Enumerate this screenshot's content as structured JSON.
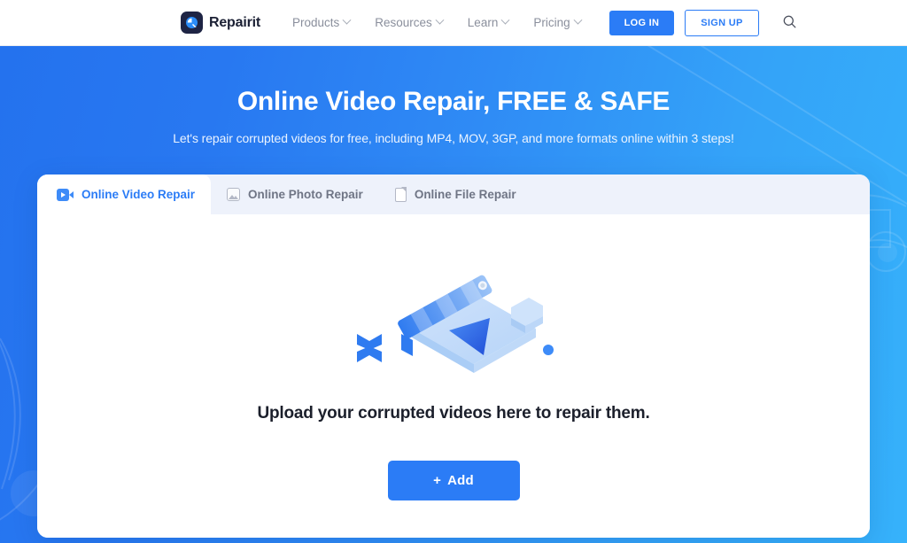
{
  "header": {
    "brand": {
      "name": "Repairit",
      "logo_icon": "repairit-logo-icon"
    },
    "nav": [
      {
        "label": "Products",
        "icon": "chevron-down-icon"
      },
      {
        "label": "Resources",
        "icon": "chevron-down-icon"
      },
      {
        "label": "Learn",
        "icon": "chevron-down-icon"
      },
      {
        "label": "Pricing",
        "icon": "chevron-down-icon"
      }
    ],
    "login_label": "LOG IN",
    "signup_label": "SIGN UP",
    "search_icon": "search-icon"
  },
  "hero": {
    "title": "Online Video Repair, FREE & SAFE",
    "subtitle": "Let's repair corrupted videos for free, including MP4, MOV, 3GP, and more formats online within 3 steps!"
  },
  "card": {
    "tabs": [
      {
        "label": "Online Video Repair",
        "icon": "video-camera-icon",
        "active": true
      },
      {
        "label": "Online Photo Repair",
        "icon": "image-icon",
        "active": false
      },
      {
        "label": "Online File Repair",
        "icon": "file-document-icon",
        "active": false
      }
    ],
    "illustration_icon": "video-clapperboard-illustration",
    "upload_text": "Upload your corrupted videos here to repair them.",
    "add_button": {
      "plus": "+",
      "label": "Add"
    }
  },
  "colors": {
    "accent_blue": "#2b7cf6",
    "hero_gradient_start": "#2472ee",
    "hero_gradient_end": "#36b2fb",
    "tabbar_bg": "#eef2fb",
    "logo_dark": "#1e2444",
    "muted_text": "#8a8f9c"
  }
}
